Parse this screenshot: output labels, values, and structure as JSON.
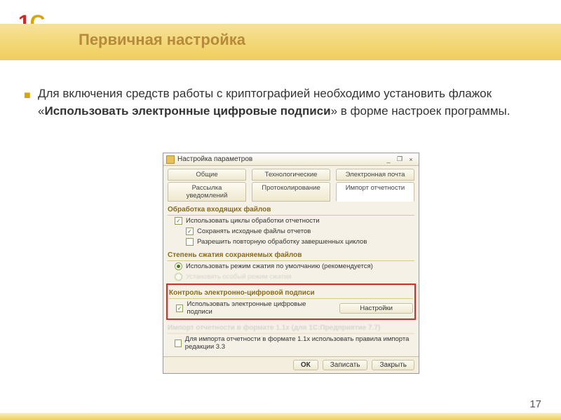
{
  "slide": {
    "title": "Первичная настройка",
    "page_number": "17",
    "body_pre": "Для включения средств работы с криптографией необходимо установить флажок «",
    "body_bold": "Использовать электронные цифровые подписи",
    "body_post": "» в форме настроек программы."
  },
  "dialog": {
    "title": "Настройка параметров",
    "win_min": "_",
    "win_rest": "❐",
    "win_close": "×",
    "tabs_row1": {
      "a": "Общие",
      "b": "Технологические",
      "c": "Электронная почта"
    },
    "tabs_row2": {
      "a": "Рассылка уведомлений",
      "b": "Протоколирование",
      "c": "Импорт отчетности"
    },
    "section1": "Обработка входящих файлов",
    "opt1": "Использовать циклы обработки отчетности",
    "opt2": "Сохранять исходные файлы отчетов",
    "opt3": "Разрешить повторную обработку завершенных циклов",
    "section2": "Степень сжатия сохраняемых файлов",
    "opt4": "Использовать режим сжатия по умолчанию (рекомендуется)",
    "opt5": "Установить особый режим сжатия",
    "section3": "Контроль электронно-цифровой подписи",
    "opt6": "Использовать электронные цифровые подписи",
    "settings_btn": "Настройки",
    "section4": "Импорт отчетности в формате 1.1x (для 1С:Предприятие 7.7)",
    "opt7": "Для импорта отчетности в формате 1.1x использовать правила импорта редакции 3.3",
    "footer": {
      "ok": "ОК",
      "save": "Записать",
      "close": "Закрыть"
    }
  }
}
